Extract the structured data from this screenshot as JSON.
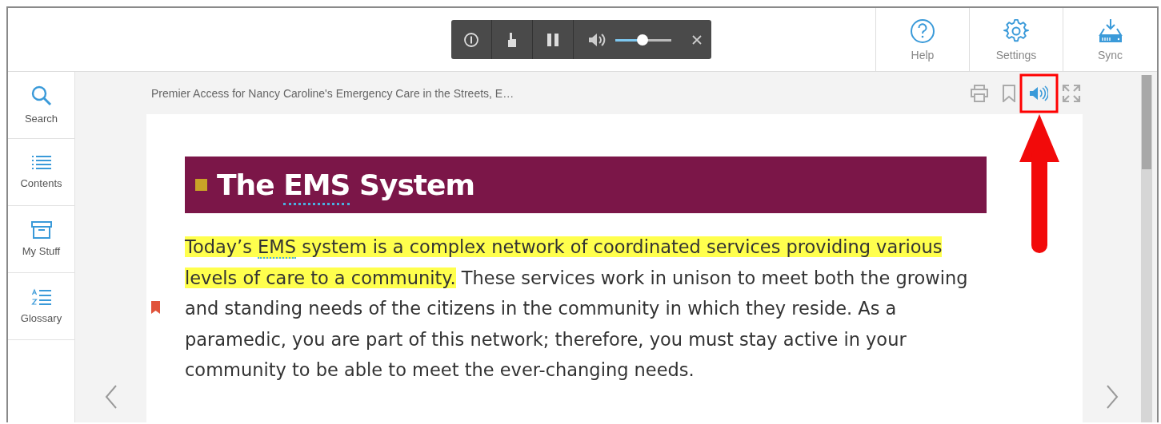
{
  "audio_player": {
    "playing": true,
    "volume": {
      "level": 0.48
    },
    "buttons": [
      {
        "kind": "info"
      },
      {
        "kind": "touch"
      }
    ]
  },
  "top_actions": [
    {
      "label": "Help",
      "kind": "help"
    },
    {
      "label": "Settings",
      "kind": "settings"
    },
    {
      "label": "Sync",
      "kind": "sync"
    }
  ],
  "sidebar": {
    "items": [
      {
        "label": "Search",
        "kind": "search"
      },
      {
        "label": "Contents",
        "kind": "contents"
      },
      {
        "label": "My Stuff",
        "kind": "mystuff"
      },
      {
        "label": "Glossary",
        "kind": "glossary"
      }
    ]
  },
  "reader": {
    "title": "Premier Access for Nancy Caroline's Emergency Care in the Streets, E…",
    "tools": [
      {
        "kind": "print",
        "selected": false
      },
      {
        "kind": "bookmark",
        "selected": false
      },
      {
        "kind": "read-aloud",
        "selected": true
      },
      {
        "kind": "fullscreen",
        "selected": false
      }
    ],
    "heading": [
      {
        "text": "The ",
        "glossary": false
      },
      {
        "text": "EMS",
        "glossary": true
      },
      {
        "text": " System",
        "glossary": false
      }
    ],
    "paragraph": {
      "bookmarked": true,
      "segments": [
        {
          "text": "Today’s ",
          "highlighted": true,
          "glossary": false
        },
        {
          "text": "EMS",
          "highlighted": true,
          "glossary": true
        },
        {
          "text": " system is a complex network of coordinated services providing various levels of care to a community.",
          "highlighted": true,
          "glossary": false
        },
        {
          "text": " These services work in unison to meet both the growing and standing needs of the citizens in the community in which they reside. As a paramedic, you are part of this network; therefore, you must stay active in your community to be able to meet the ever-changing needs.",
          "highlighted": false,
          "glossary": false
        }
      ]
    }
  }
}
